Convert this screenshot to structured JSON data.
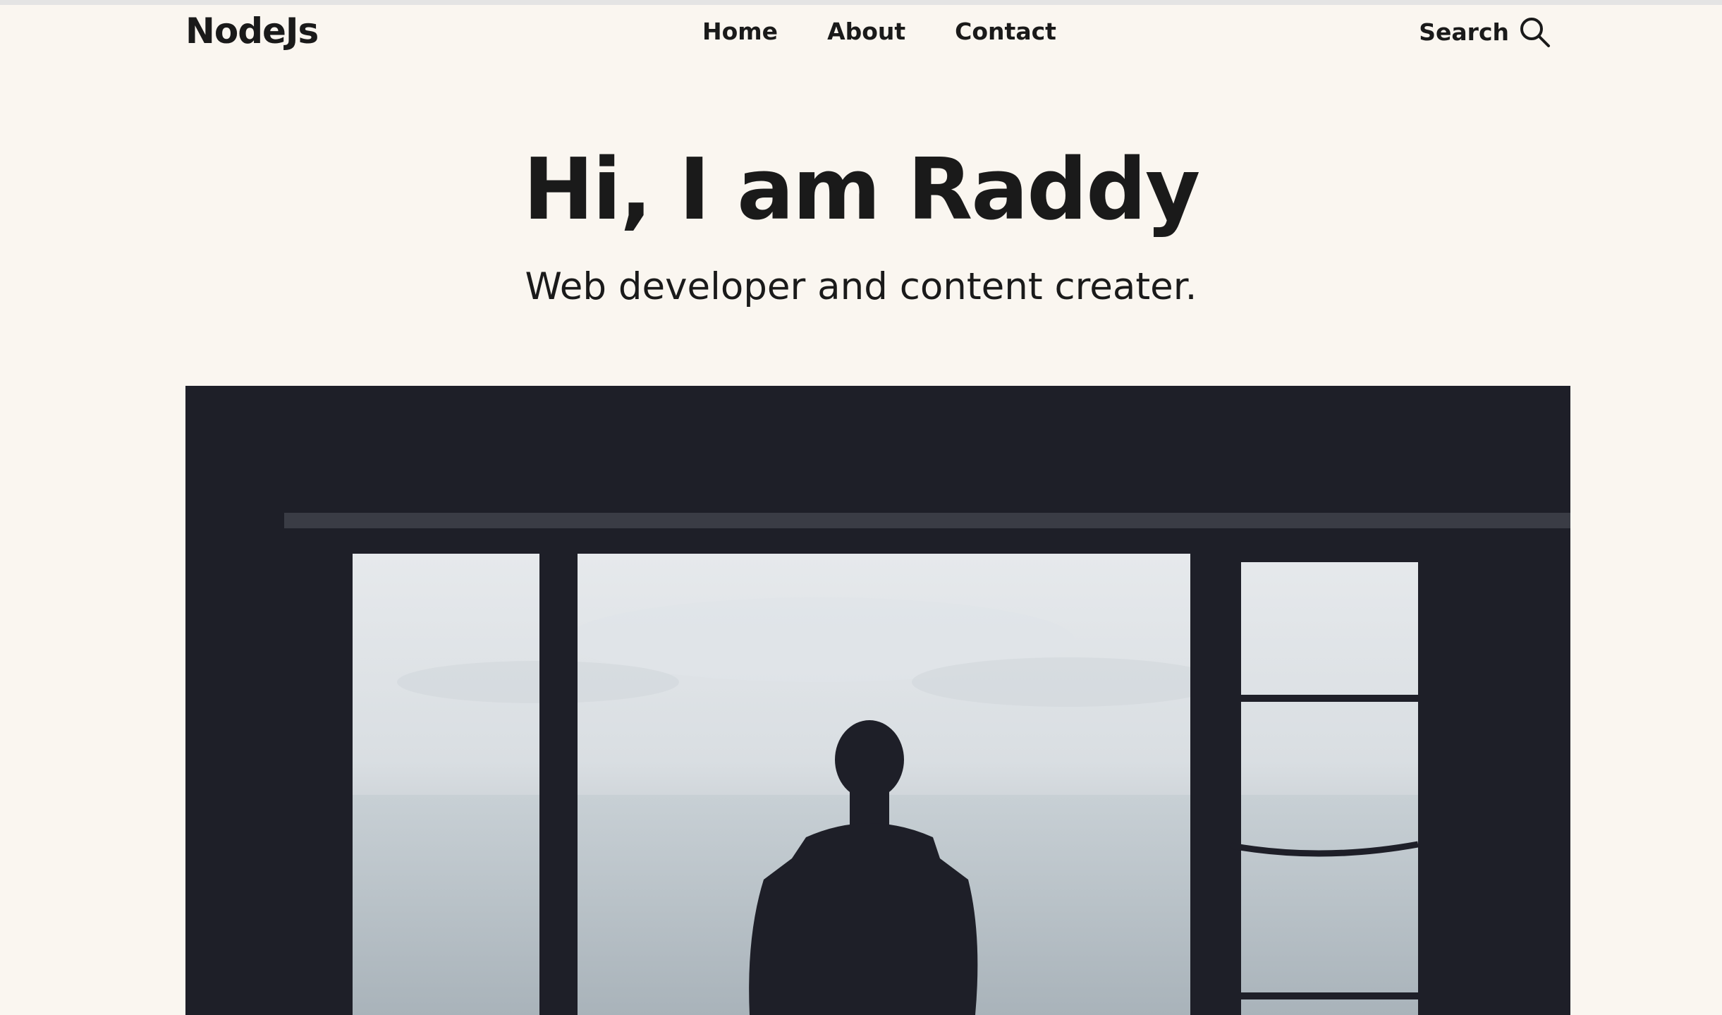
{
  "header": {
    "logo": "NodeJs",
    "nav": [
      {
        "label": "Home"
      },
      {
        "label": "About"
      },
      {
        "label": "Contact"
      }
    ],
    "search_label": "Search",
    "search_icon": "search-icon"
  },
  "hero": {
    "title": "Hi, I am Raddy",
    "subtitle": "Web developer and content creater."
  },
  "colors": {
    "background": "#FAF6F0",
    "text": "#1A1A1A",
    "image_dark": "#1E1F28"
  }
}
